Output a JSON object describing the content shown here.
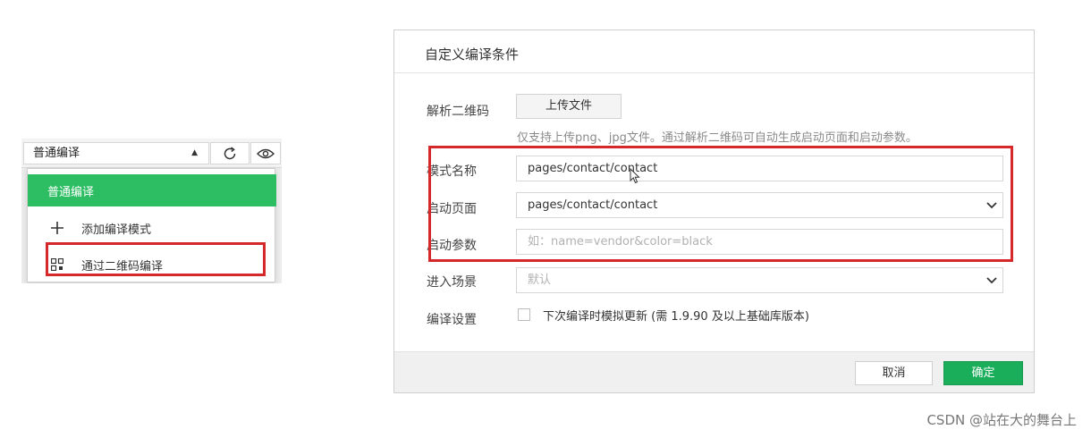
{
  "left_panel": {
    "mode_select": {
      "value": "普通编译"
    },
    "dropdown": {
      "items": [
        {
          "label": "普通编译",
          "active": true
        },
        {
          "label": "添加编译模式",
          "icon": "plus-icon"
        },
        {
          "label": "通过二维码编译",
          "icon": "qrcode-icon"
        }
      ]
    },
    "icons": {
      "refresh": "refresh-icon",
      "preview": "eye-icon",
      "caret": "caret-up-icon"
    }
  },
  "dialog": {
    "title": "自定义编译条件",
    "qrcode": {
      "label": "解析二维码",
      "upload_label": "上传文件",
      "hint": "仅支持上传png、jpg文件。通过解析二维码可自动生成启动页面和启动参数。"
    },
    "mode_name": {
      "label": "模式名称",
      "value": "pages/contact/contact"
    },
    "start_page": {
      "label": "启动页面",
      "value": "pages/contact/contact"
    },
    "start_params": {
      "label": "启动参数",
      "placeholder": "如：name=vendor&color=black"
    },
    "scene": {
      "label": "进入场景",
      "placeholder": "默认"
    },
    "compile_settings": {
      "label": "编译设置",
      "checkbox_label": "下次编译时模拟更新 (需 1.9.90 及以上基础库版本)",
      "checked": false
    },
    "footer": {
      "cancel_label": "取消",
      "ok_label": "确定"
    }
  },
  "colors": {
    "accent_green": "#1aad5a",
    "highlight_red": "#d4282b"
  },
  "watermark": "CSDN @站在大的舞台上"
}
